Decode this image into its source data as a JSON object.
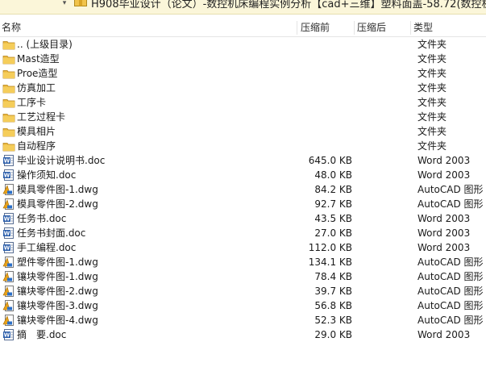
{
  "window": {
    "title": "H908毕业设计（论文）-数控机床编程实例分析【cad+三维】塑料面盖-58.72(数控机床编程"
  },
  "columns": {
    "name": "名称",
    "compressed_size": "压缩前",
    "uncompressed_size": "压缩后",
    "type": "类型"
  },
  "rows": [
    {
      "name": ".. (上级目录)",
      "size": "",
      "type": "文件夹",
      "icon": "folder-icon"
    },
    {
      "name": "Mast造型",
      "size": "",
      "type": "文件夹",
      "icon": "folder-icon"
    },
    {
      "name": "Proe造型",
      "size": "",
      "type": "文件夹",
      "icon": "folder-icon"
    },
    {
      "name": "仿真加工",
      "size": "",
      "type": "文件夹",
      "icon": "folder-icon"
    },
    {
      "name": "工序卡",
      "size": "",
      "type": "文件夹",
      "icon": "folder-icon"
    },
    {
      "name": "工艺过程卡",
      "size": "",
      "type": "文件夹",
      "icon": "folder-icon"
    },
    {
      "name": "模具相片",
      "size": "",
      "type": "文件夹",
      "icon": "folder-icon"
    },
    {
      "name": "自动程序",
      "size": "",
      "type": "文件夹",
      "icon": "folder-icon"
    },
    {
      "name": "毕业设计说明书.doc",
      "size": "645.0 KB",
      "type": "Word 2003",
      "icon": "word-doc-icon"
    },
    {
      "name": "操作须知.doc",
      "size": "48.0 KB",
      "type": "Word 2003",
      "icon": "word-doc-icon"
    },
    {
      "name": "模具零件图-1.dwg",
      "size": "84.2 KB",
      "type": "AutoCAD 图形",
      "icon": "autocad-dwg-icon"
    },
    {
      "name": "模具零件图-2.dwg",
      "size": "92.7 KB",
      "type": "AutoCAD 图形",
      "icon": "autocad-dwg-icon"
    },
    {
      "name": "任务书.doc",
      "size": "43.5 KB",
      "type": "Word 2003",
      "icon": "word-doc-icon"
    },
    {
      "name": "任务书封面.doc",
      "size": "27.0 KB",
      "type": "Word 2003",
      "icon": "word-doc-icon"
    },
    {
      "name": "手工编程.doc",
      "size": "112.0 KB",
      "type": "Word 2003",
      "icon": "word-doc-icon"
    },
    {
      "name": "塑件零件图-1.dwg",
      "size": "134.1 KB",
      "type": "AutoCAD 图形",
      "icon": "autocad-dwg-icon"
    },
    {
      "name": "镶块零件图-1.dwg",
      "size": "78.4 KB",
      "type": "AutoCAD 图形",
      "icon": "autocad-dwg-icon"
    },
    {
      "name": "镶块零件图-2.dwg",
      "size": "39.7 KB",
      "type": "AutoCAD 图形",
      "icon": "autocad-dwg-icon"
    },
    {
      "name": "镶块零件图-3.dwg",
      "size": "56.8 KB",
      "type": "AutoCAD 图形",
      "icon": "autocad-dwg-icon"
    },
    {
      "name": "镶块零件图-4.dwg",
      "size": "52.3 KB",
      "type": "AutoCAD 图形",
      "icon": "autocad-dwg-icon"
    },
    {
      "name": "摘　要.doc",
      "size": "29.0 KB",
      "type": "Word 2003",
      "icon": "word-doc-icon"
    }
  ]
}
